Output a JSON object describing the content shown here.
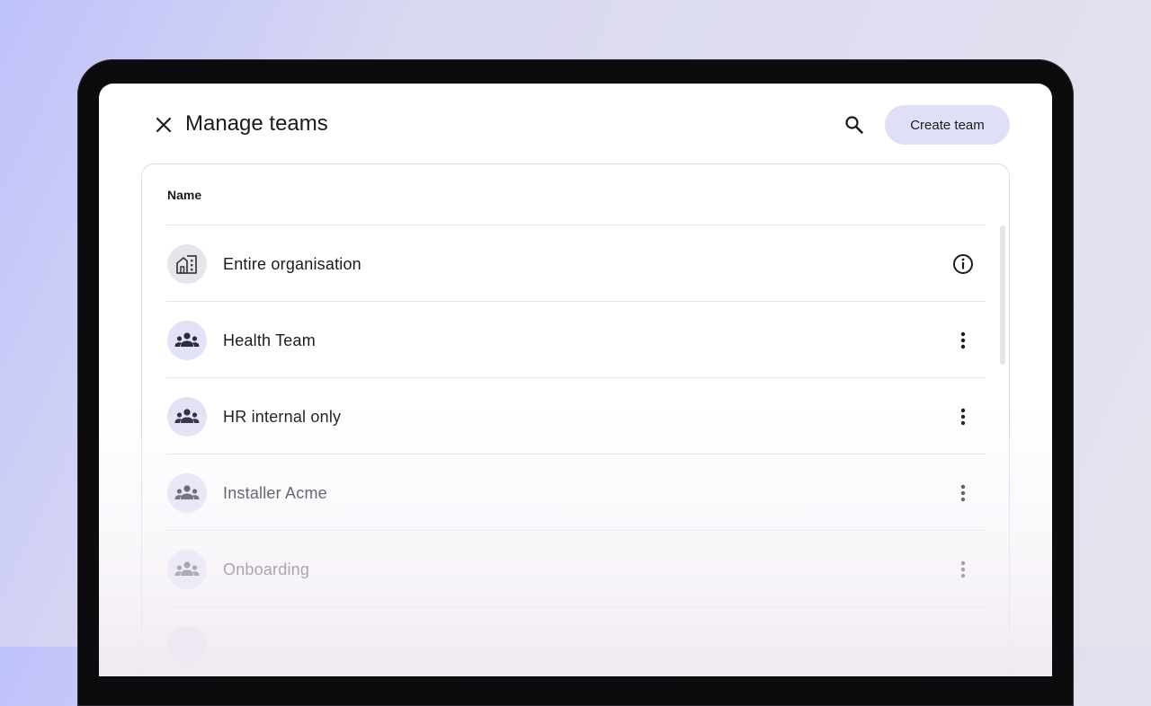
{
  "header": {
    "title": "Manage teams",
    "create_label": "Create team",
    "close_icon": "close-icon",
    "search_icon": "search-icon"
  },
  "table": {
    "column_name": "Name",
    "rows": [
      {
        "label": "Entire organisation",
        "icon": "building-icon",
        "action": "info-icon"
      },
      {
        "label": "Health Team",
        "icon": "group-icon",
        "action": "more-vert-icon"
      },
      {
        "label": "HR internal only",
        "icon": "group-icon",
        "action": "more-vert-icon"
      },
      {
        "label": "Installer Acme",
        "icon": "group-icon",
        "action": "more-vert-icon"
      },
      {
        "label": "Onboarding",
        "icon": "group-icon",
        "action": "more-vert-icon"
      }
    ]
  },
  "colors": {
    "accent_button": "#e0dff8",
    "avatar_bg": "#e2e2f7",
    "text_primary": "#1b1b1f"
  }
}
